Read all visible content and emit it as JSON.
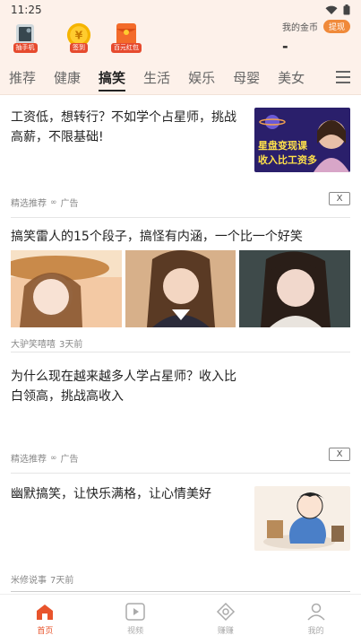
{
  "status": {
    "time": "11:25"
  },
  "header": {
    "items": [
      {
        "label": "抽手机",
        "icon": "phone-prize-icon"
      },
      {
        "label": "签到",
        "icon": "yen-coin-icon",
        "glyph": "¥"
      },
      {
        "label": "百元红包",
        "icon": "red-envelope-icon"
      }
    ],
    "coins_label": "我的金币",
    "withdraw_label": "提现",
    "coins_value": "-"
  },
  "tabs": [
    {
      "label": "推荐",
      "active": false
    },
    {
      "label": "健康",
      "active": false
    },
    {
      "label": "搞笑",
      "active": true
    },
    {
      "label": "生活",
      "active": false
    },
    {
      "label": "娱乐",
      "active": false
    },
    {
      "label": "母婴",
      "active": false
    },
    {
      "label": "美女",
      "active": false
    }
  ],
  "feed": [
    {
      "title": "工资低，想转行？不如学个占星师，挑战高薪，不限基础!",
      "source": "精选推荐",
      "ad_label": "广告",
      "close": "X",
      "thumb_text": "星盘变现课 收入比工资多"
    },
    {
      "title": "搞笑雷人的15个段子，搞怪有内涵，一个比一个好笑",
      "source": "大驴笑嘻嘻",
      "time": "3天前"
    },
    {
      "title": "为什么现在越来越多人学占星师？收入比白领高，挑战高收入",
      "source": "精选推荐",
      "ad_label": "广告",
      "close": "X"
    },
    {
      "title": "幽默搞笑，让快乐满格，让心情美好",
      "source": "米修说事",
      "time": "7天前"
    }
  ],
  "bottom_nav": [
    {
      "label": "首页",
      "icon": "home-icon",
      "active": true
    },
    {
      "label": "视频",
      "icon": "video-icon",
      "active": false
    },
    {
      "label": "赚赚",
      "icon": "earn-icon",
      "active": false
    },
    {
      "label": "我的",
      "icon": "profile-icon",
      "active": false
    }
  ],
  "colors": {
    "accent": "#e8542c",
    "header_bg": "#fdf1ea",
    "withdraw": "#f08a3a"
  }
}
